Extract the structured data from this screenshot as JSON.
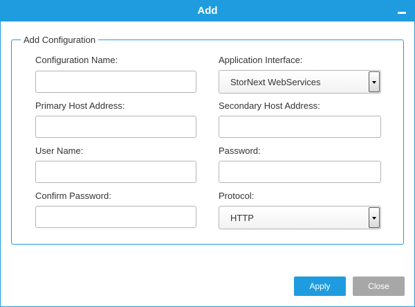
{
  "window": {
    "title": "Add",
    "minimize_icon": "minimize-icon"
  },
  "form": {
    "legend": "Add Configuration",
    "configuration_name": {
      "label": "Configuration Name:",
      "value": ""
    },
    "application_interface": {
      "label": "Application Interface:",
      "selected": "StorNext WebServices"
    },
    "primary_host": {
      "label": "Primary Host Address:",
      "value": ""
    },
    "secondary_host": {
      "label": "Secondary Host Address:",
      "value": ""
    },
    "user_name": {
      "label": "User Name:",
      "value": ""
    },
    "password": {
      "label": "Password:",
      "value": ""
    },
    "confirm_password": {
      "label": "Confirm Password:",
      "value": ""
    },
    "protocol": {
      "label": "Protocol:",
      "selected": "HTTP"
    }
  },
  "footer": {
    "apply_label": "Apply",
    "close_label": "Close"
  },
  "colors": {
    "accent": "#1e9cdf",
    "close_button": "#a7a7a7",
    "border": "#b4b4b4"
  }
}
